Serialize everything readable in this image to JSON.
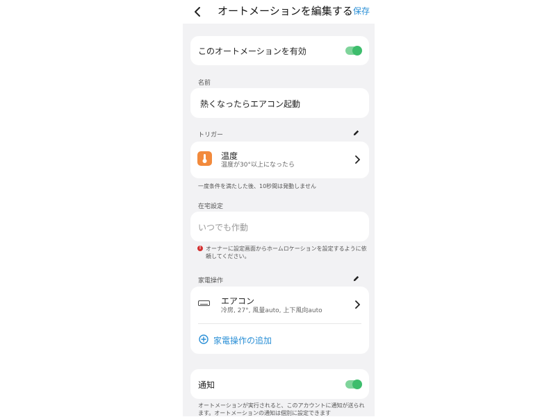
{
  "header": {
    "title": "オートメーションを編集する",
    "save_label": "保存"
  },
  "enable": {
    "label": "このオートメーションを有効",
    "on": true
  },
  "name_section": {
    "label": "名前",
    "value": "熱くなったらエアコン起動"
  },
  "trigger_section": {
    "label": "トリガー",
    "item_title": "温度",
    "item_subtitle": "温度が30°以上になったら",
    "note": "一度条件を満たした後、10秒間は発動しません"
  },
  "presence_section": {
    "label": "在宅設定",
    "value": "いつでも作動",
    "warning": "オーナーに設定画面からホームロケーションを設定するように依頼してください。"
  },
  "appliance_section": {
    "label": "家電操作",
    "item_title": "エアコン",
    "item_subtitle": "冷房, 27°, 風量auto, 上下風向auto",
    "add_label": "家電操作の追加"
  },
  "notify": {
    "label": "通知",
    "on": true,
    "note": "オートメーションが実行されると、このアカウントに通知が送られます。オートメーションの通知は個別に設定できます"
  },
  "icons": {
    "back": "chevron-left-icon",
    "edit": "pencil-icon",
    "chevron": "chevron-right-icon",
    "thermometer": "thermometer-icon",
    "air_conditioner": "air-conditioner-icon",
    "add": "plus-circle-icon",
    "warning": "exclamation-circle-icon"
  },
  "colors": {
    "accent": "#2a8fd6",
    "toggle_on": "#3dbd6c",
    "temp_icon_bg": "#f28a3c",
    "warning": "#d32f2f"
  }
}
